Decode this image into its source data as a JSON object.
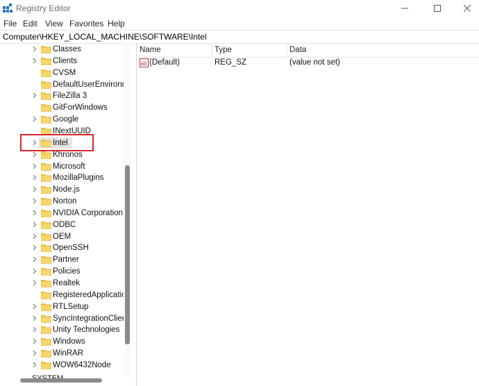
{
  "window": {
    "title": "Registry Editor"
  },
  "menu": {
    "items": [
      "File",
      "Edit",
      "View",
      "Favorites",
      "Help"
    ]
  },
  "address": {
    "path": "Computer\\HKEY_LOCAL_MACHINE\\SOFTWARE\\Intel"
  },
  "tree": {
    "items": [
      {
        "label": "Classes",
        "expandable": true
      },
      {
        "label": "Clients",
        "expandable": true
      },
      {
        "label": "CVSM",
        "expandable": false
      },
      {
        "label": "DefaultUserEnvironm",
        "expandable": false
      },
      {
        "label": "FileZilla 3",
        "expandable": true
      },
      {
        "label": "GitForWindows",
        "expandable": false
      },
      {
        "label": "Google",
        "expandable": true
      },
      {
        "label": "INextUUID",
        "expandable": false
      },
      {
        "label": "Intel",
        "expandable": true,
        "selected": true
      },
      {
        "label": "Khronos",
        "expandable": true
      },
      {
        "label": "Microsoft",
        "expandable": true
      },
      {
        "label": "MozillaPlugins",
        "expandable": true
      },
      {
        "label": "Node.js",
        "expandable": true
      },
      {
        "label": "Norton",
        "expandable": true
      },
      {
        "label": "NVIDIA Corporation",
        "expandable": true
      },
      {
        "label": "ODBC",
        "expandable": true
      },
      {
        "label": "OEM",
        "expandable": true
      },
      {
        "label": "OpenSSH",
        "expandable": true
      },
      {
        "label": "Partner",
        "expandable": true
      },
      {
        "label": "Policies",
        "expandable": true
      },
      {
        "label": "Realtek",
        "expandable": true
      },
      {
        "label": "RegisteredApplication",
        "expandable": false
      },
      {
        "label": "RTLSetup",
        "expandable": true
      },
      {
        "label": "SyncIntegrationClient",
        "expandable": true
      },
      {
        "label": "Unity Technologies",
        "expandable": true
      },
      {
        "label": "Windows",
        "expandable": true
      },
      {
        "label": "WinRAR",
        "expandable": true
      },
      {
        "label": "WOW6432Node",
        "expandable": true
      }
    ],
    "partial_item": "SYSTEM"
  },
  "list": {
    "columns": [
      "Name",
      "Type",
      "Data"
    ],
    "rows": [
      {
        "name": "(Default)",
        "type": "REG_SZ",
        "data": "(value not set)"
      }
    ]
  },
  "colors": {
    "highlight_box": "#d8262b",
    "folder": "#f3c94f",
    "icon_blue": "#1e6fc2"
  }
}
